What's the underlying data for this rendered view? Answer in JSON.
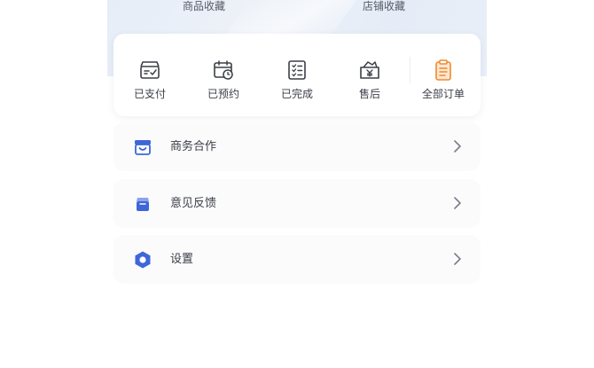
{
  "favorites": {
    "goods_label": "商品收藏",
    "shop_label": "店铺收藏"
  },
  "orders": {
    "items": [
      {
        "label": "已支付",
        "icon": "paid-box-icon"
      },
      {
        "label": "已预约",
        "icon": "scheduled-calendar-icon"
      },
      {
        "label": "已完成",
        "icon": "completed-checklist-icon"
      },
      {
        "label": "售后",
        "icon": "after-sales-yuan-icon"
      },
      {
        "label": "全部订单",
        "icon": "all-orders-clipboard-icon"
      }
    ],
    "highlight_color": "#f08a2c"
  },
  "menu": {
    "items": [
      {
        "label": "商务合作",
        "icon": "business-store-icon"
      },
      {
        "label": "意见反馈",
        "icon": "feedback-box-icon"
      },
      {
        "label": "设置",
        "icon": "settings-hexagon-icon"
      }
    ],
    "accent_color": "#3f66d9"
  }
}
